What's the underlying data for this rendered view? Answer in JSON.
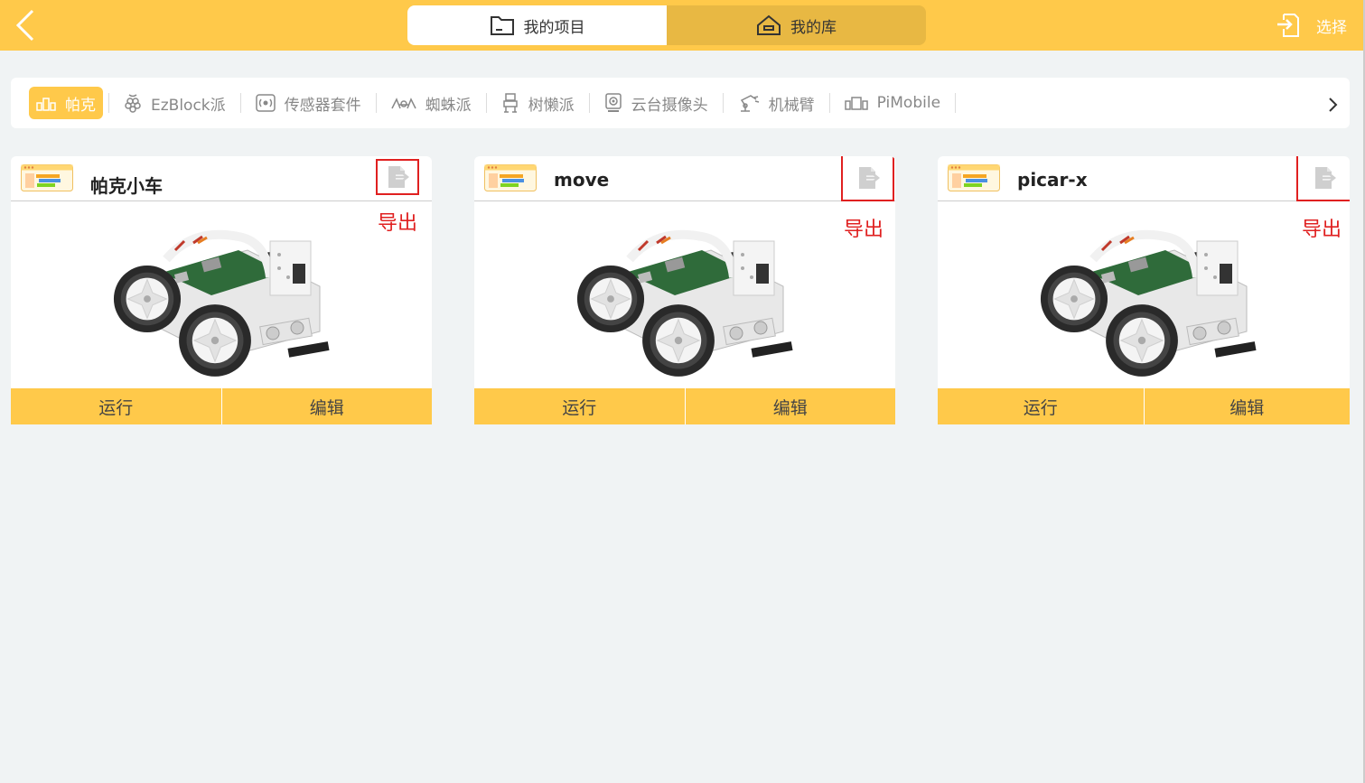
{
  "header": {
    "tabs": [
      {
        "label": "我的项目",
        "icon": "folder-icon"
      },
      {
        "label": "我的库",
        "icon": "home-icon"
      }
    ],
    "select_label": "选择"
  },
  "categories": [
    {
      "label": "帕克",
      "icon": "robot-blocks-icon"
    },
    {
      "label": "EzBlock派",
      "icon": "raspberry-icon"
    },
    {
      "label": "传感器套件",
      "icon": "sensor-icon"
    },
    {
      "label": "蜘蛛派",
      "icon": "spider-icon"
    },
    {
      "label": "树懒派",
      "icon": "sloth-icon"
    },
    {
      "label": "云台摄像头",
      "icon": "camera-icon"
    },
    {
      "label": "机械臂",
      "icon": "robot-arm-icon"
    },
    {
      "label": "PiMobile",
      "icon": "mobile-car-icon"
    }
  ],
  "projects": [
    {
      "title": "帕克小车",
      "export_label": "导出",
      "run_label": "运行",
      "edit_label": "编辑"
    },
    {
      "title": "move",
      "export_label": "导出",
      "run_label": "运行",
      "edit_label": "编辑"
    },
    {
      "title": "picar-x",
      "export_label": "导出",
      "run_label": "运行",
      "edit_label": "编辑"
    }
  ],
  "colors": {
    "accent": "#ffc94a",
    "highlight": "#e02020",
    "background": "#f0f3f4"
  }
}
